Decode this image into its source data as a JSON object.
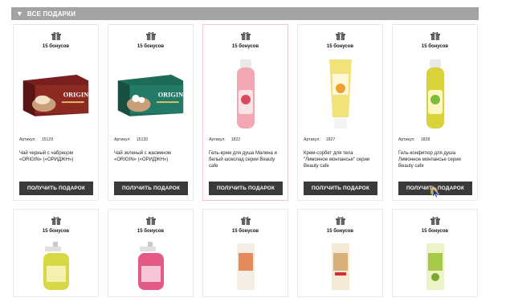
{
  "header": {
    "title": "ВСЕ ПОДАРКИ",
    "chevron_icon": "chevron-down-icon"
  },
  "gift_icon": "gift-icon",
  "row1": [
    {
      "bonus": "15 бонусов",
      "article_label": "Артикул:",
      "article": "15129",
      "name": "Чай черный с чабрецом «ORIGIN» («ОРИДЖН»)",
      "button": "ПОЛУЧИТЬ ПОДАРОК",
      "product": "tea-box-red"
    },
    {
      "bonus": "15 бонусов",
      "article_label": "Артикул:",
      "article": "15130",
      "name": "Чай зеленый с жасмином «ORIGIN» («ОРИДЖН»)",
      "button": "ПОЛУЧИТЬ ПОДАРОК",
      "product": "tea-box-green"
    },
    {
      "bonus": "15 бонусов",
      "article_label": "Артикул:",
      "article": "1822",
      "name": "Гель-крем для душа Малина и белый шоколад серии Beauty cafe",
      "button": "ПОЛУЧИТЬ ПОДАРОК",
      "product": "pink-bottle"
    },
    {
      "bonus": "15 бонусов",
      "article_label": "Артикул:",
      "article": "1827",
      "name": "Крем-сорбет для тела \"Лимонное монпансье\" серии Beauty cafe",
      "button": "ПОЛУЧИТЬ ПОДАРОК",
      "product": "yellow-tube"
    },
    {
      "bonus": "15 бонусов",
      "article_label": "Артикул:",
      "article": "1828",
      "name": "Гель-конфитюр для душа Лимонное монпансье серии Beauty cafe",
      "button": "ПОЛУЧИТЬ ПОДАРОК",
      "product": "yellow-bottle"
    }
  ],
  "row2": [
    {
      "bonus": "15 бонусов",
      "product": "soap-yellow"
    },
    {
      "bonus": "15 бонусов",
      "product": "soap-pink"
    },
    {
      "bonus": "15 бонусов",
      "product": "tube-peach"
    },
    {
      "bonus": "15 бонусов",
      "product": "tube-cream"
    },
    {
      "bonus": "15 бонусов",
      "product": "tube-green"
    }
  ],
  "colors": {
    "header_bg": "#a3a3a3",
    "button_bg": "#3a3a3a",
    "highlight_border": "#f2c4cc"
  }
}
